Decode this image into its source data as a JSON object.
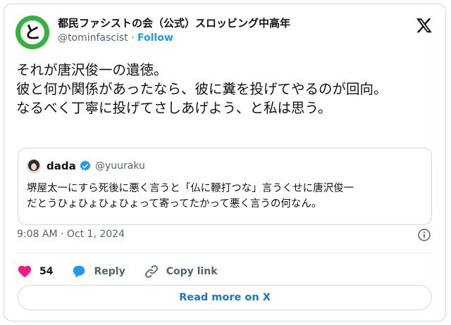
{
  "author": {
    "display_name": "都民ファシストの会（公式）スロッビング中高年",
    "handle": "@tominfascist",
    "separator": "·",
    "follow_label": "Follow",
    "avatar_glyph": "と"
  },
  "tweet": {
    "text": "それが唐沢俊一の遺徳。\n彼と何か関係があったなら、彼に糞を投げてやるのが回向。\nなるべく丁寧に投げてさしあげよう、と私は思う。",
    "timestamp": "9:08 AM · Oct 1, 2024"
  },
  "quote": {
    "name": "dada",
    "handle": "@yuuraku",
    "text": "堺屋太一にすら死後に悪く言うと「仏に鞭打つな」言うくせに唐沢俊一\nだとうひょひょひょひょって寄ってたかって悪く言うの何なん。"
  },
  "actions": {
    "like_count": "54",
    "reply_label": "Reply",
    "copy_link_label": "Copy link"
  },
  "read_more_label": "Read more on X",
  "colors": {
    "accent": "#1d9bf0",
    "like": "#f91880",
    "avatar_ring": "#2fb43c",
    "secondary_text": "#536471",
    "border": "#cfd9de"
  },
  "icons": [
    "x-logo-icon",
    "verified-badge-icon",
    "info-icon",
    "heart-icon",
    "reply-bubble-icon",
    "link-icon"
  ]
}
